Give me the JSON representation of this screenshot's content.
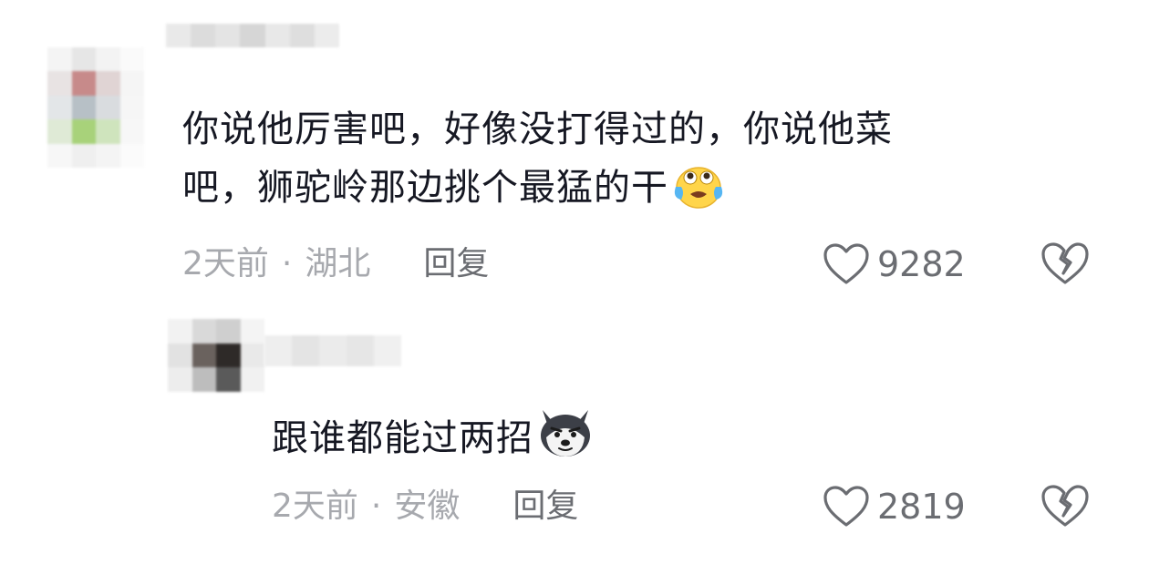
{
  "comments": [
    {
      "text_line1": "你说他厉害吧，好像没打得过的，你说他菜",
      "text_line2": "吧，狮驼岭那边挑个最猛的干",
      "emoji": "crying-face-emoji",
      "time": "2天前",
      "separator": "·",
      "location": "湖北",
      "reply_label": "回复",
      "likes": "9282",
      "avatar_colors": [
        "#f4f4f4",
        "#e6e6e6",
        "#f3f3f3",
        "#fafafa",
        "#e8e3e3",
        "#c78a8a",
        "#e0d4d4",
        "#f5f5f5",
        "#e3e6e8",
        "#b7c0c6",
        "#d9dcdf",
        "#f6f6f6",
        "#dfead6",
        "#a8d27a",
        "#cfe4bd",
        "#f7f7f7",
        "#f7f7f7",
        "#efefef",
        "#f4f4f4",
        "#fbfbfb"
      ],
      "username_colors": [
        "#e9e9e9",
        "#dcdcdc",
        "#e4e4e4",
        "#d6d6d6",
        "#e8e8e8",
        "#dedede",
        "#ececec"
      ]
    },
    {
      "text": "跟谁都能过两招",
      "emoji": "husky-dog-emoji",
      "time": "2天前",
      "separator": "·",
      "location": "安徽",
      "reply_label": "回复",
      "likes": "2819",
      "avatar_colors": [
        "#f2f2f2",
        "#d9d9d9",
        "#cfcfcf",
        "#f4f4f4",
        "#e2e2e2",
        "#6a625e",
        "#2e2a28",
        "#e9e9e9",
        "#ededed",
        "#bdbdbd",
        "#5a5a5a",
        "#f1f1f1"
      ],
      "username_colors": [
        "#eeeeee",
        "#e4e4e4",
        "#ebebeb",
        "#e6e6e6",
        "#f0f0f0"
      ]
    }
  ],
  "icons": {
    "like": "heart-outline-icon",
    "dislike": "broken-heart-icon"
  },
  "colors": {
    "text": "#161823",
    "meta": "#a7a9ae",
    "action": "#6b6d72"
  }
}
